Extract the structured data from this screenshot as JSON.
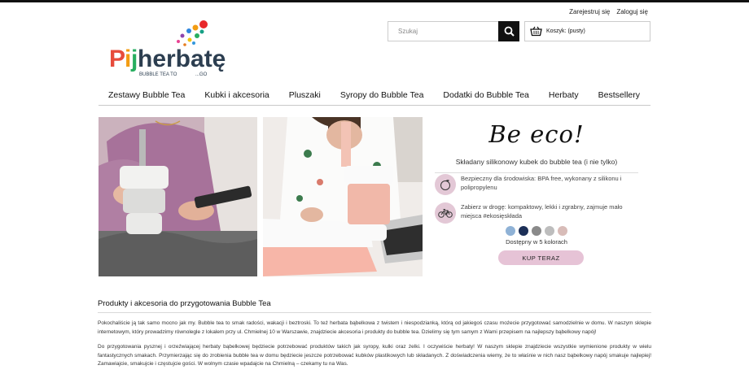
{
  "account": {
    "register": "Zarejestruj się",
    "login": "Zaloguj się"
  },
  "logo": {
    "brand": "Pijherbatę",
    "tagline": "BUBBLE TEA TO",
    "tagline_go": "...GO"
  },
  "search": {
    "placeholder": "Szukaj"
  },
  "cart": {
    "label": "Koszyk: (pusty)"
  },
  "nav": {
    "items": [
      "Zestawy Bubble Tea",
      "Kubki i akcesoria",
      "Pluszaki",
      "Syropy do Bubble Tea",
      "Dodatki do Bubble Tea",
      "Herbaty",
      "Bestsellery"
    ]
  },
  "promo": {
    "headline": "Be eco!",
    "subtitle": "Składany silikonowy kubek do bubble tea (i nie tylko)",
    "feature1": "Bezpieczny dla środowiska: BPA free, wykonany z silikonu i polipropylenu",
    "feature2": "Zabierz w drogę: kompaktowy, lekki i zgrabny, zajmuje mało miejsca #ekosięskłada",
    "swatch_colors": [
      "#8fb2d6",
      "#1c2f57",
      "#8a8a8a",
      "#bdbdbd",
      "#d8bcb8"
    ],
    "colors_label": "Dostępny w 5 kolorach",
    "button": "KUP TERAZ"
  },
  "content": {
    "heading": "Produkty i akcesoria do przygotowania Bubble Tea",
    "paragraph1": "Pokochaliście ją tak samo mocno jak my. Bubble tea to smak radości, wakacji i beztroski. To też herbata bąbelkowa z twistem i niespodzianką, którą od jakiegoś czasu możecie przygotować samodzielnie w domu. W naszym sklepie internetowym, który prowadzimy równolegle z lokalem przy ul. Chmielnej 10 w Warszawie, znajdziecie akcesoria i produkty do bubble tea. Dzielimy się tym samym z Wami przepisem na najlepszy bąbelkowy napój!",
    "paragraph2": "Do przygotowania pysznej i orzeźwiającej herbaty bąbelkowej będziecie potrzebować produktów takich jak syropy, kulki oraz żelki. I oczywiście herbaty! W naszym sklepie znajdziecie wszystkie wymienione produkty w wielu fantastycznych smakach. Przymierzając się do zrobienia bubble tea w domu będziecie jeszcze potrzebować kubków plastikowych lub składanych. Z doświadczenia wiemy, że to właśnie w nich nasz bąbelkowy napój smakuje najlepiej! Zamawiajcie, smakujcie i częstujcie gości. W wolnym czasie wpadajcie na Chmielną – czekamy tu na Was."
  }
}
